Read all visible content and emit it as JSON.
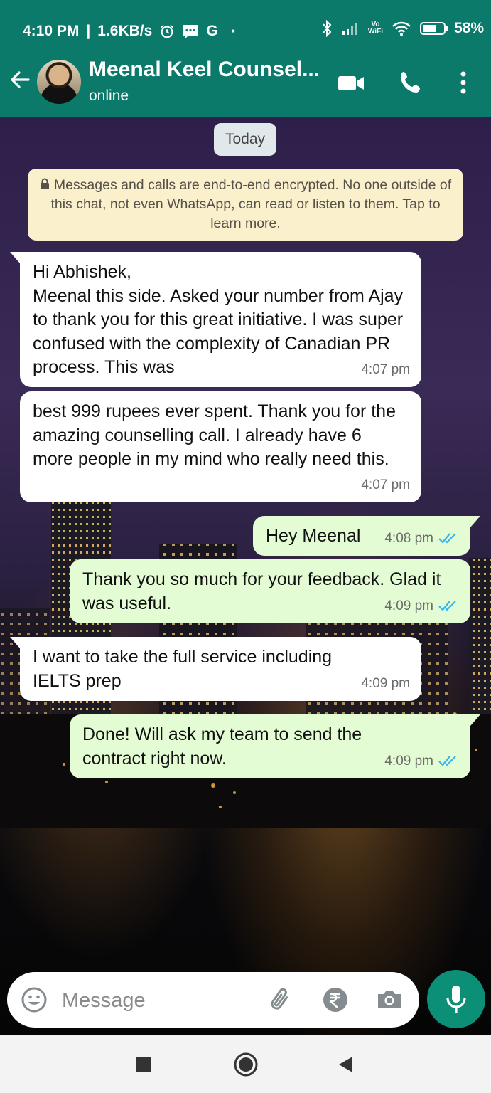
{
  "status_bar": {
    "time": "4:10 PM",
    "speed": "1.6KB/s",
    "carrier_letter": "G",
    "dot": "·",
    "vowifi_top": "Vo",
    "vowifi_bottom": "WiFi",
    "battery": "58%",
    "battery_level": 0.58
  },
  "header": {
    "contact_name": "Meenal Keel Counsel...",
    "status": "online",
    "icons": [
      "back-arrow-icon",
      "video-call-icon",
      "phone-icon",
      "more-vert-icon"
    ]
  },
  "chat": {
    "date_label": "Today",
    "encryption_notice": "Messages and calls are end-to-end encrypted. No one outside of this chat, not even WhatsApp, can read or listen to them. Tap to learn more.",
    "messages": [
      {
        "direction": "in",
        "text": "Hi Abhishek,\nMeenal this side. Asked your number from Ajay to thank you for this great initiative. I was super confused with the complexity of Canadian PR process. This was",
        "time": "4:07 pm"
      },
      {
        "direction": "in",
        "text": "best 999 rupees ever spent. Thank you for the amazing counselling call. I already have 6 more people in my mind who really need this.",
        "time": "4:07 pm"
      },
      {
        "direction": "out",
        "text": "Hey Meenal",
        "time": "4:08 pm",
        "read": true
      },
      {
        "direction": "out",
        "text": "Thank you so much for your feedback. Glad it was useful.",
        "time": "4:09 pm",
        "read": true
      },
      {
        "direction": "in",
        "text": "I want to take the full service including IELTS prep",
        "time": "4:09 pm"
      },
      {
        "direction": "out",
        "text": "Done! Will ask my team to send the contract right now.",
        "time": "4:09 pm",
        "read": true
      }
    ]
  },
  "composer": {
    "placeholder": "Message",
    "icons": [
      "emoji-icon",
      "attach-icon",
      "rupee-payment-icon",
      "camera-icon",
      "mic-icon"
    ]
  },
  "nav_bar": {
    "icons": [
      "recents-square-icon",
      "home-circle-icon",
      "back-triangle-icon"
    ]
  },
  "colors": {
    "header": "#0b7a6b",
    "incoming_bubble": "#ffffff",
    "outgoing_bubble": "#e4fcd4",
    "encryption_bg": "#fbf0cc",
    "read_ticks": "#34b7f1",
    "mic_button": "#0b8f77"
  }
}
